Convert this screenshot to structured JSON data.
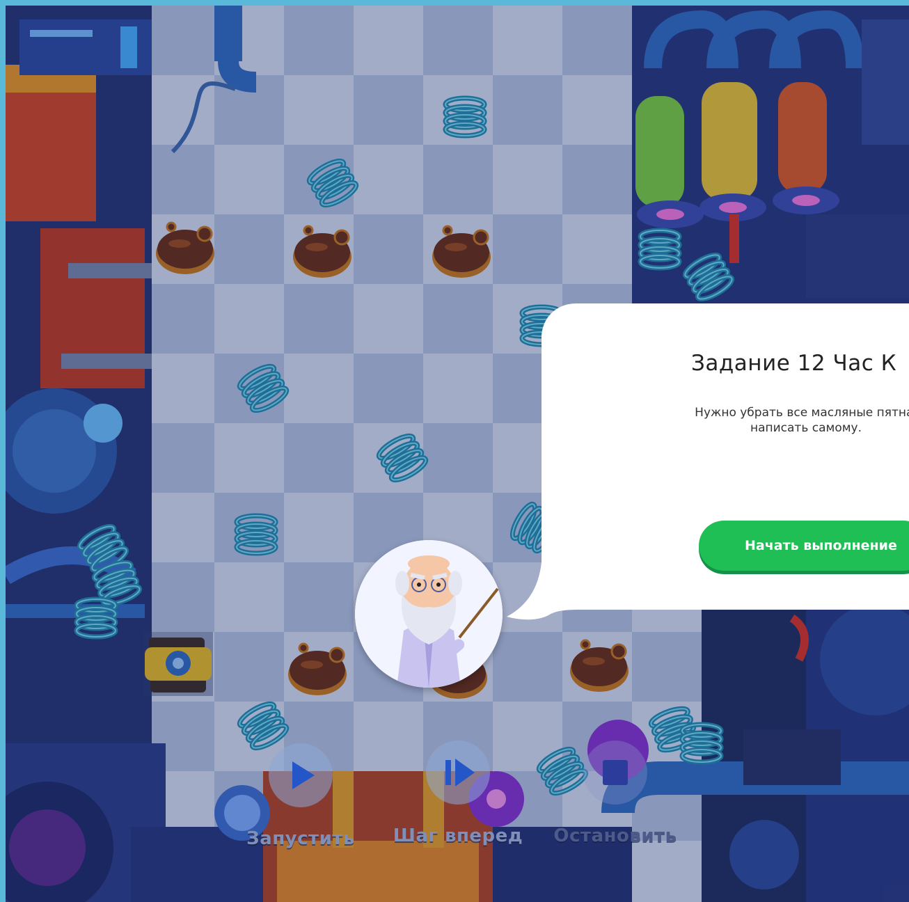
{
  "controls": {
    "run_label": "Запустить",
    "step_label": "Шаг вперед",
    "stop_label": "Остановить"
  },
  "dialog": {
    "title": "Задание 12 Час К",
    "text": "Нужно убрать все масляные пятна.\nнаписать самому.",
    "start_button": "Начать выполнение"
  },
  "colors": {
    "button_green": "#1fbf55",
    "control_blue": "#2456c8",
    "frame": "#5ab9d8"
  }
}
